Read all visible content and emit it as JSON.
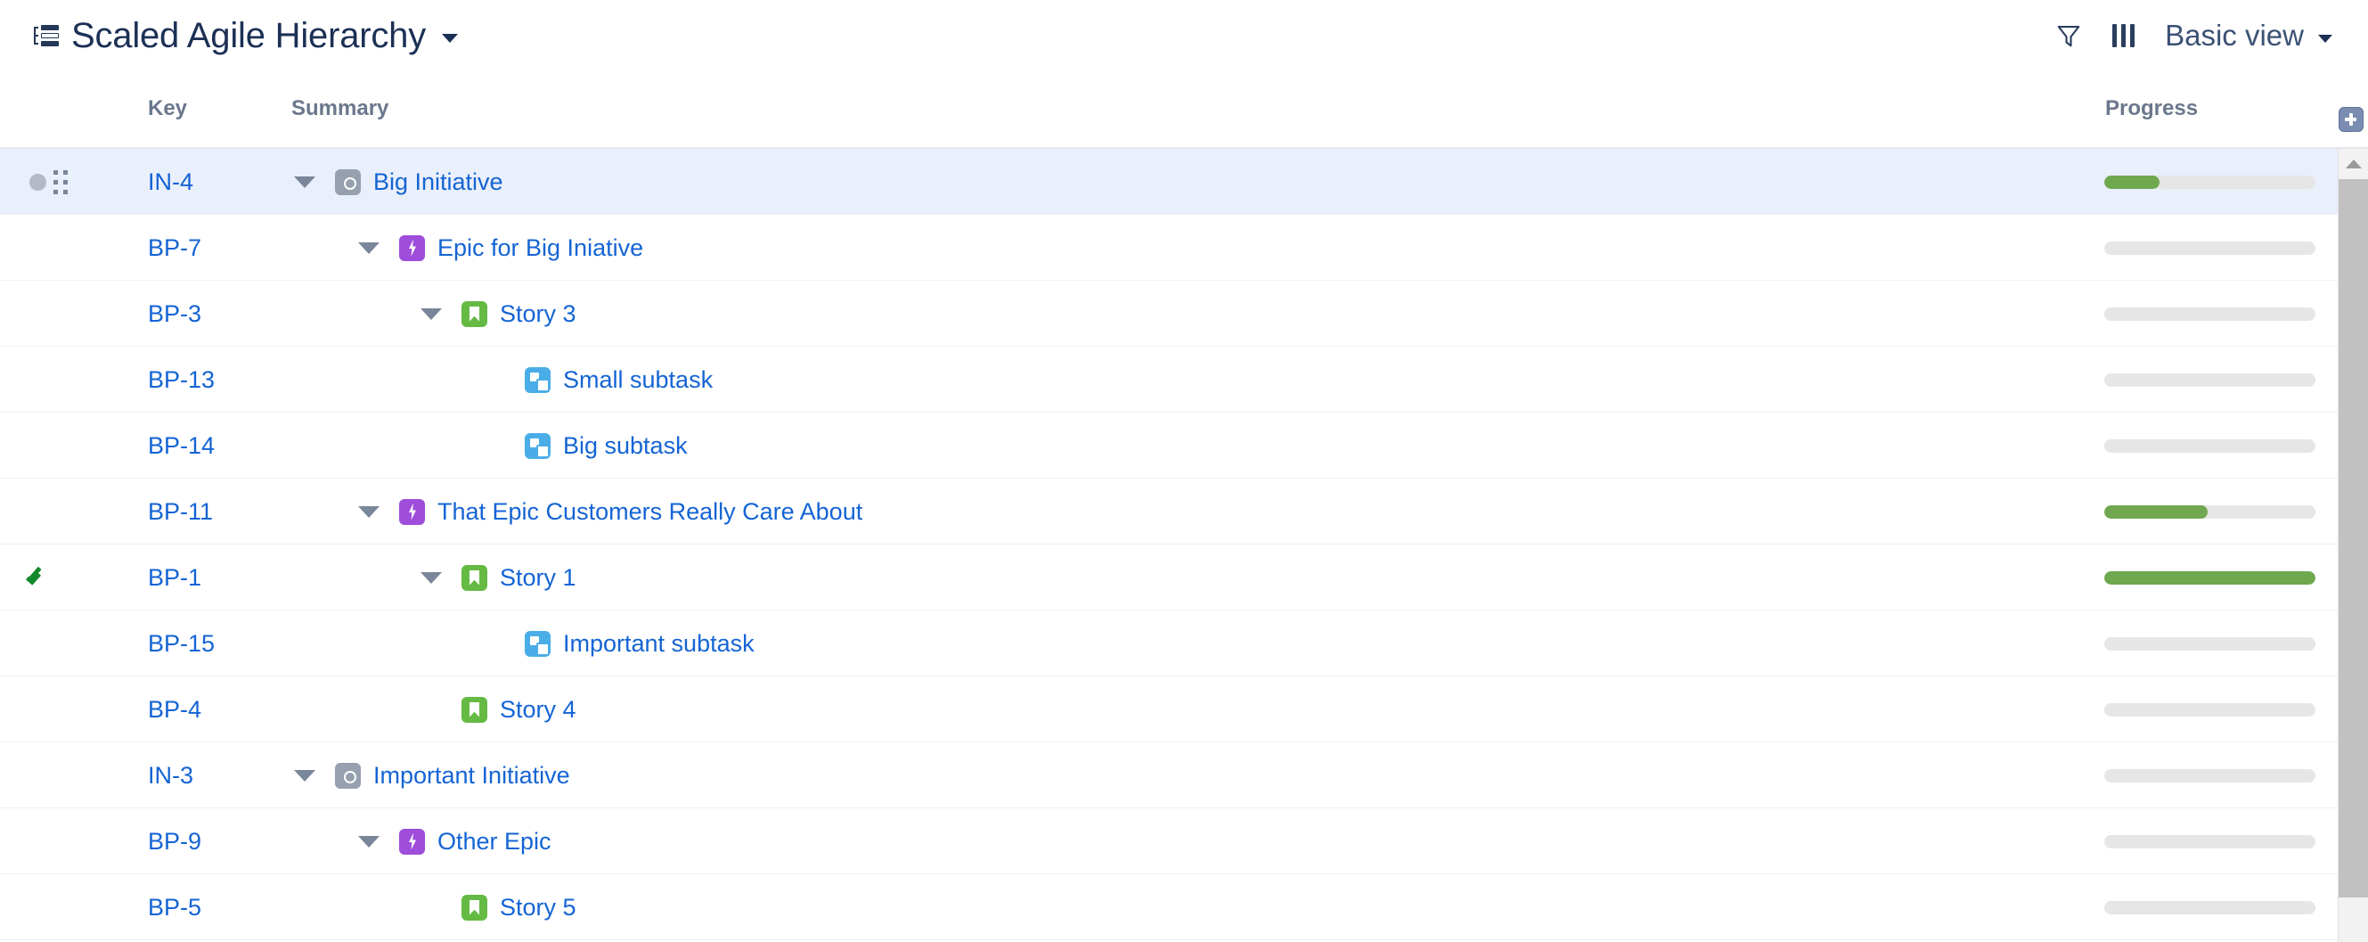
{
  "header": {
    "board_icon": "hierarchy-icon",
    "title": "Scaled Agile Hierarchy",
    "title_chevron": "chevron-down-icon",
    "filter_icon": "filter-icon",
    "columns_icon": "columns-icon",
    "view_label": "Basic view",
    "view_chevron": "chevron-down-icon"
  },
  "columns": {
    "key": "Key",
    "summary": "Summary",
    "progress": "Progress",
    "add_column_icon": "plus-icon"
  },
  "colors": {
    "link": "#1464d4",
    "selected_row": "#e9effb",
    "progress_fill": "#6fa84f",
    "progress_track": "#e6e6e6",
    "initiative": "#97a0af",
    "epic": "#9f4ddb",
    "story": "#65ba43",
    "subtask": "#4bade8",
    "check": "#14892c",
    "header_text": "#6b778c",
    "title_text": "#1c3055"
  },
  "rows": [
    {
      "key": "IN-4",
      "summary": "Big Initiative",
      "type": "initiative",
      "indent": 0,
      "expanded": true,
      "selected": true,
      "status": "dot",
      "drag_handle": true,
      "progress": 26
    },
    {
      "key": "BP-7",
      "summary": "Epic for Big Iniative",
      "type": "epic",
      "indent": 1,
      "expanded": true,
      "selected": false,
      "status": "none",
      "drag_handle": false,
      "progress": 0
    },
    {
      "key": "BP-3",
      "summary": "Story 3",
      "type": "story",
      "indent": 2,
      "expanded": true,
      "selected": false,
      "status": "none",
      "drag_handle": false,
      "progress": 0
    },
    {
      "key": "BP-13",
      "summary": "Small subtask",
      "type": "subtask",
      "indent": 3,
      "expanded": false,
      "selected": false,
      "status": "none",
      "drag_handle": false,
      "progress": 0
    },
    {
      "key": "BP-14",
      "summary": "Big subtask",
      "type": "subtask",
      "indent": 3,
      "expanded": false,
      "selected": false,
      "status": "none",
      "drag_handle": false,
      "progress": 0
    },
    {
      "key": "BP-11",
      "summary": "That Epic Customers Really Care About",
      "type": "epic",
      "indent": 1,
      "expanded": true,
      "selected": false,
      "status": "none",
      "drag_handle": false,
      "progress": 49
    },
    {
      "key": "BP-1",
      "summary": "Story 1",
      "type": "story",
      "indent": 2,
      "expanded": true,
      "selected": false,
      "status": "check",
      "drag_handle": false,
      "progress": 100
    },
    {
      "key": "BP-15",
      "summary": "Important subtask",
      "type": "subtask",
      "indent": 3,
      "expanded": false,
      "selected": false,
      "status": "none",
      "drag_handle": false,
      "progress": 0
    },
    {
      "key": "BP-4",
      "summary": "Story 4",
      "type": "story",
      "indent": 2,
      "expanded": false,
      "selected": false,
      "status": "none",
      "drag_handle": false,
      "progress": 0
    },
    {
      "key": "IN-3",
      "summary": "Important Initiative",
      "type": "initiative",
      "indent": 0,
      "expanded": true,
      "selected": false,
      "status": "none",
      "drag_handle": false,
      "progress": 0
    },
    {
      "key": "BP-9",
      "summary": "Other Epic",
      "type": "epic",
      "indent": 1,
      "expanded": true,
      "selected": false,
      "status": "none",
      "drag_handle": false,
      "progress": 0
    },
    {
      "key": "BP-5",
      "summary": "Story 5",
      "type": "story",
      "indent": 2,
      "expanded": false,
      "selected": false,
      "status": "none",
      "drag_handle": false,
      "progress": 0
    }
  ],
  "scrollbar": {
    "up_arrow_icon": "chevron-up-icon",
    "thumb_visible": true
  }
}
